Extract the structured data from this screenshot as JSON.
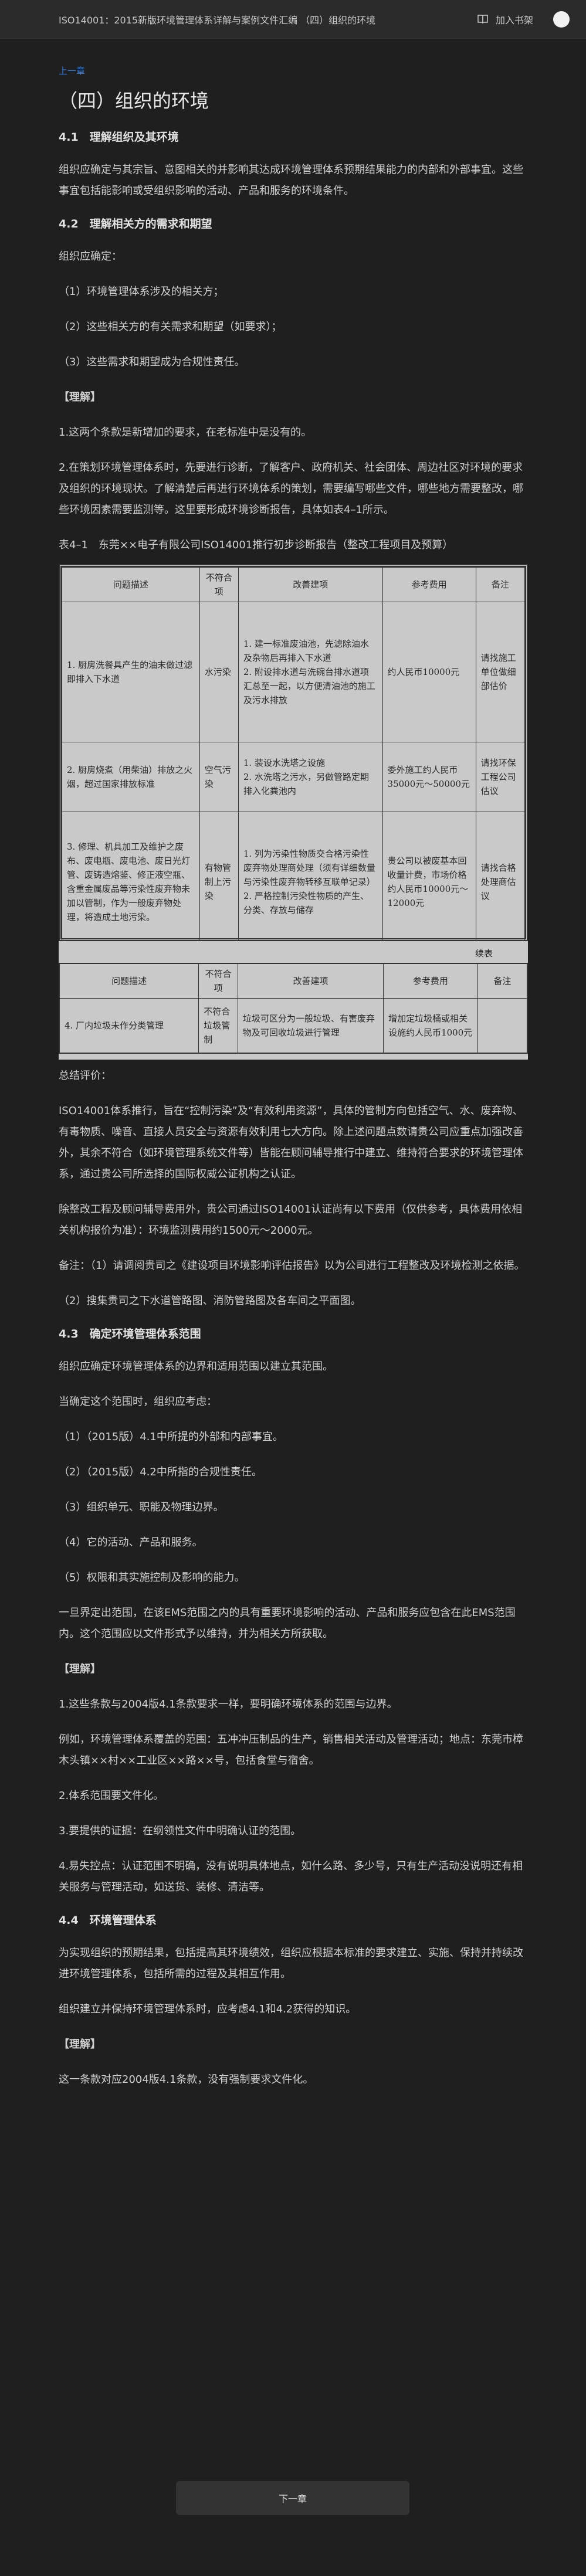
{
  "header": {
    "title": "ISO14001：2015新版环境管理体系详解与案例文件汇编 （四）组织的环境",
    "bookmark_label": "加入书架"
  },
  "nav": {
    "prev_label": "上一章",
    "next_label": "下一章"
  },
  "page_title": "（四）组织的环境",
  "s41": {
    "heading": "4.1　理解组织及其环境",
    "p1": "组织应确定与其宗旨、意图相关的并影响其达成环境管理体系预期结果能力的内部和外部事宜。这些事宜包括能影响或受组织影响的活动、产品和服务的环境条件。"
  },
  "s42": {
    "heading": "4.2　理解相关方的需求和期望",
    "intro": "组织应确定：",
    "items": [
      "（1）环境管理体系涉及的相关方；",
      "（2）这些相关方的有关需求和期望（如要求）；",
      "（3）这些需求和期望成为合规性责任。"
    ],
    "understand": "【理解】",
    "u1": "1.这两个条款是新增加的要求，在老标准中是没有的。",
    "u2": "2.在策划环境管理体系时，先要进行诊断，了解客户、政府机关、社会团体、周边社区对环境的要求及组织的环境现状。了解清楚后再进行环境体系的策划，需要编写哪些文件，哪些地方需要整改，哪些环境因素需要监测等。这里要形成环境诊断报告，具体如表4–1所示。",
    "table_caption": "表4–1　东莞××电子有限公司ISO14001推行初步诊断报告（整改工程项目及预算）"
  },
  "table1": {
    "headers": [
      "问题描述",
      "不符合项",
      "改善建项",
      "参考费用",
      "备注"
    ],
    "rows": [
      [
        "1. 厨房洗餐具产生的油末做过滤即排入下水道",
        "水污染",
        "1. 建一标准废油池，先滤除油水及杂物后再排入下水道\n2. 附设排水道与洗碗台排水道项汇总至一起，以方便清油池的施工及污水排放",
        "约人民币10000元",
        "请找施工单位做细部估价"
      ],
      [
        "2. 厨房烧煮（用柴油）排放之火烟，超过国家排放标准",
        "空气污染",
        "1. 装设水洗塔之设施\n2. 水洗塔之污水，另做管路定期排入化粪池内",
        "委外施工约人民币35000元～50000元",
        "请找环保工程公司估议"
      ],
      [
        "3. 修理、机具加工及维护之废布、废电瓶、废电池、废日光灯管、废铸造熔鉴、修正液空瓶、含重金属废品等污染性废弃物未加以管制，作为一般废弃物处理，将造成土地污染。",
        "有物管制上污染",
        "1. 列为污染性物质交合格污染性废弃物处理商处理（须有详细数量与污染性废弃物转移互联单记录）\n2. 严格控制污染性物质的产生、分类、存放与储存",
        "贵公司以被废基本回收量计费，市场价格约人民币10000元～12000元",
        "请找合格处理商估议"
      ]
    ],
    "continued_label": "续表",
    "rows2": [
      [
        "4. 厂内垃圾未作分类管理",
        "不符合垃圾管制",
        "垃圾可区分为一般垃圾、有害废弃物及可回收垃圾进行管理",
        "增加定垃圾桶或相关设施约人民币1000元",
        ""
      ]
    ]
  },
  "review": {
    "label": "总结评价：",
    "p1": "ISO14001体系推行，旨在“控制污染”及“有效利用资源”，具体的管制方向包括空气、水、废弃物、有毒物质、噪音、直接人员安全与资源有效利用七大方向。除上述问题点数请贵公司应重点加强改善外，其余不符合（如环境管理系统文件等）皆能在顾问辅导推行中建立、维持符合要求的环境管理体系，通过贵公司所选择的国际权威公证机构之认证。",
    "p2": "除整改工程及顾问辅导费用外，贵公司通过ISO14001认证尚有以下费用（仅供参考，具体费用依相关机构报价为准）：环境监测费用约1500元～2000元。",
    "p3": "备注：（1）请调阅贵司之《建设项目环境影响评估报告》以为公司进行工程整改及环境检测之依据。",
    "p4": "（2）搜集贵司之下水道管路图、消防管路图及各车间之平面图。"
  },
  "s43": {
    "heading": "4.3　确定环境管理体系范围",
    "p1": "组织应确定环境管理体系的边界和适用范围以建立其范围。",
    "p2": "当确定这个范围时，组织应考虑：",
    "items": [
      "（1）（2015版）4.1中所提的外部和内部事宜。",
      "（2）（2015版）4.2中所指的合规性责任。",
      "（3）组织单元、职能及物理边界。",
      "（4）它的活动、产品和服务。",
      "（5）权限和其实施控制及影响的能力。"
    ],
    "p3": "一旦界定出范围，在该EMS范围之内的具有重要环境影响的活动、产品和服务应包含在此EMS范围内。这个范围应以文件形式予以维持，并为相关方所获取。",
    "understand": "【理解】",
    "u1": "1.这些条款与2004版4.1条款要求一样，要明确环境体系的范围与边界。",
    "u2": "例如，环境管理体系覆盖的范围：五冲冲压制品的生产，销售相关活动及管理活动；地点：东莞市樟木头镇××村××工业区××路××号，包括食堂与宿舍。",
    "u3": "2.体系范围要文件化。",
    "u4": "3.要提供的证据：在纲领性文件中明确认证的范围。",
    "u5": "4.易失控点：认证范围不明确，没有说明具体地点，如什么路、多少号，只有生产活动没说明还有相关服务与管理活动，如送货、装修、清洁等。"
  },
  "s44": {
    "heading": "4.4　环境管理体系",
    "p1": "为实现组织的预期结果，包括提高其环境绩效，组织应根据本标准的要求建立、实施、保持并持续改进环境管理体系，包括所需的过程及其相互作用。",
    "p2": "组织建立并保持环境管理体系时，应考虑4.1和4.2获得的知识。",
    "understand": "【理解】",
    "u1": "这一条款对应2004版4.1条款，没有强制要求文件化。"
  },
  "colors": {
    "background": "#1f1f1f",
    "link": "#2f7fe6",
    "text": "#d4d4d4",
    "scan_bg": "#c9c9c9"
  },
  "icons": {
    "bookmark": "book-icon",
    "avatar": "avatar"
  }
}
